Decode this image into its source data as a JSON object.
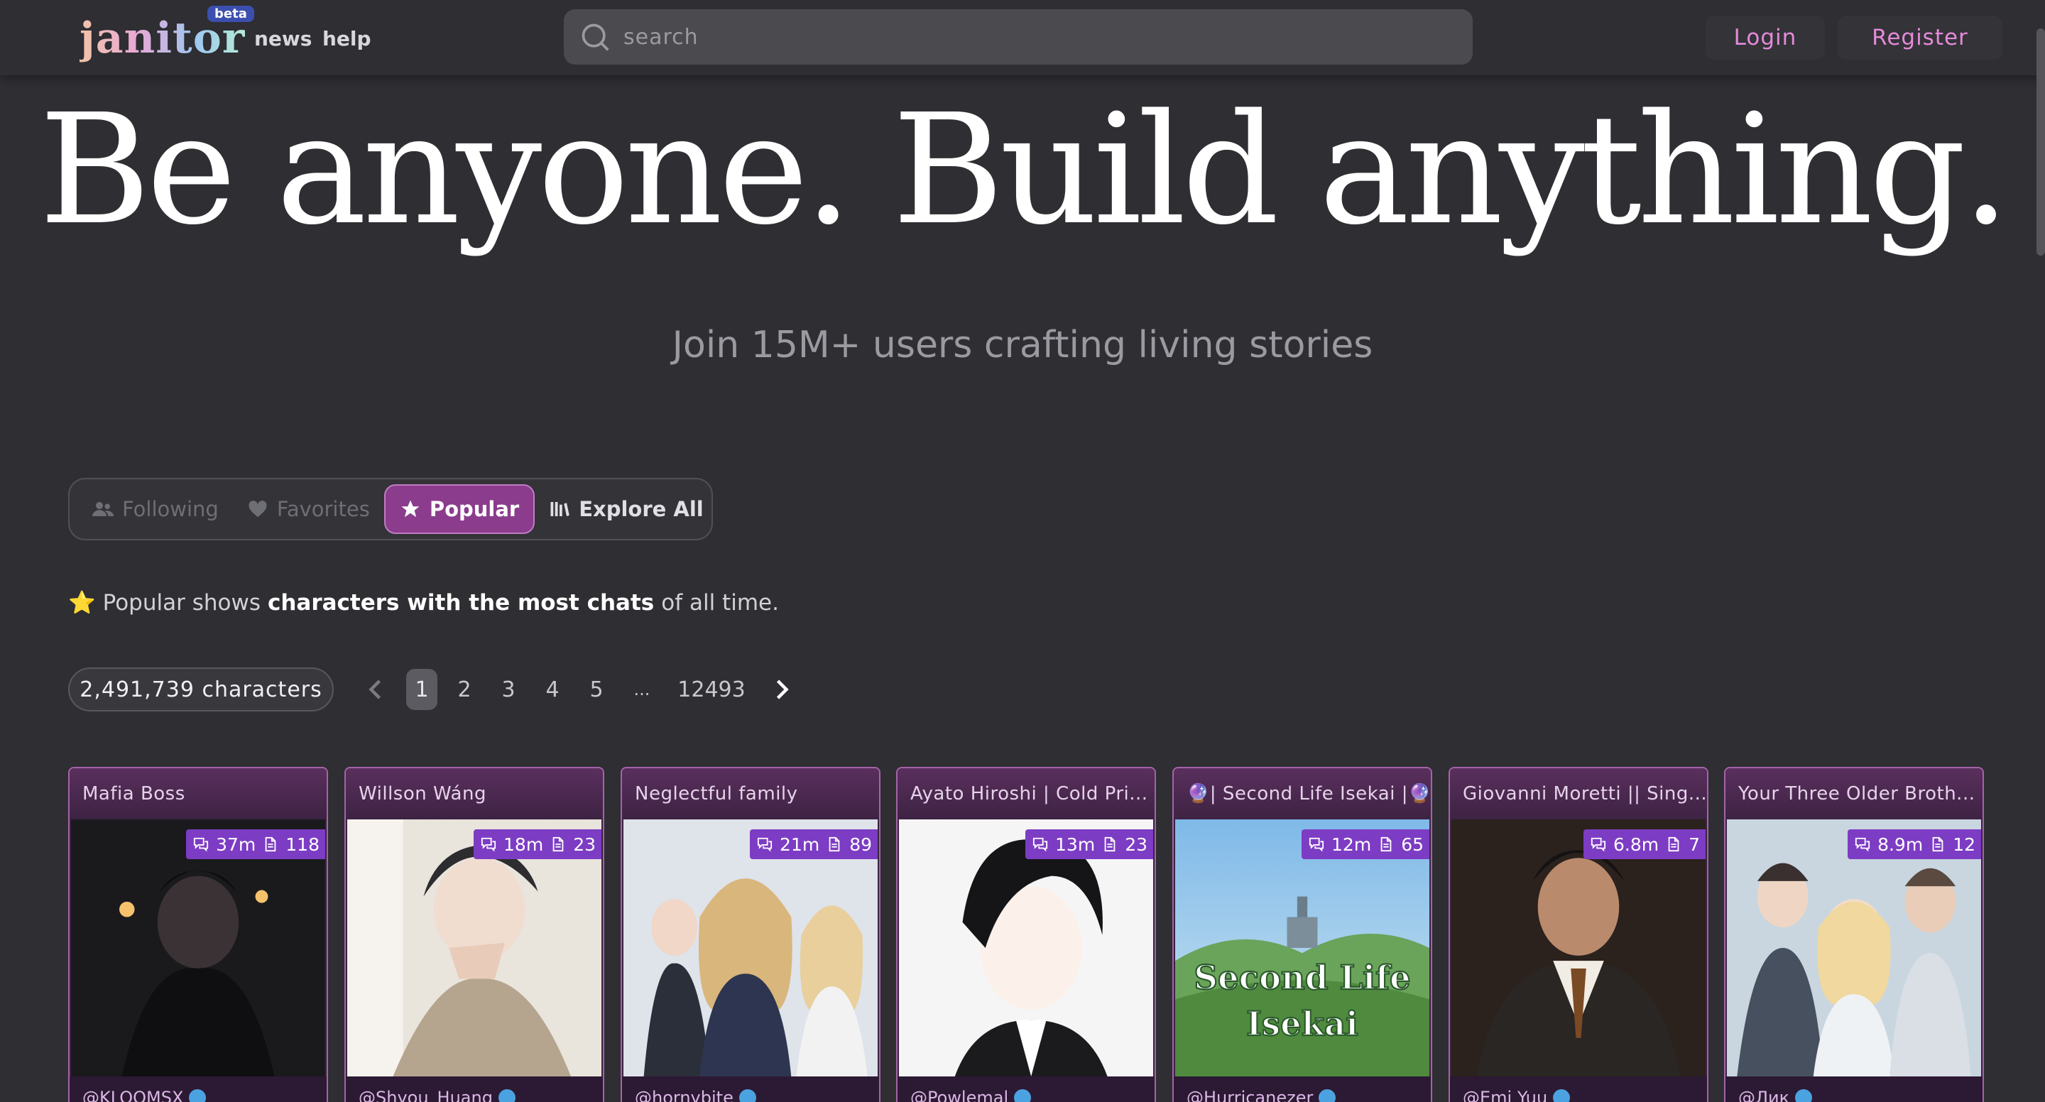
{
  "header": {
    "logo_text": "janitor",
    "beta_label": "beta",
    "nav": [
      {
        "label": "news"
      },
      {
        "label": "help"
      }
    ],
    "search": {
      "placeholder": "search",
      "value": ""
    },
    "login_label": "Login",
    "register_label": "Register"
  },
  "hero": {
    "title": "Be anyone. Build anything.",
    "subtitle": "Join 15M+ users crafting living stories"
  },
  "tabs": [
    {
      "label": "Following",
      "icon": "users-icon",
      "active": false
    },
    {
      "label": "Favorites",
      "icon": "heart-icon",
      "active": false
    },
    {
      "label": "Popular",
      "icon": "star-icon",
      "active": true
    },
    {
      "label": "Explore All",
      "icon": "library-icon",
      "active": false
    }
  ],
  "info": {
    "emoji": "⭐",
    "part1": "Popular shows",
    "part2": "characters with the most chats",
    "part3": "of all time."
  },
  "pagination": {
    "count_label": "2,491,739 characters",
    "pages": [
      "1",
      "2",
      "3",
      "4",
      "5",
      "...",
      "12493"
    ],
    "current": "1"
  },
  "cards": [
    {
      "title": "Mafia Boss",
      "chats": "37m",
      "messages": "118",
      "author": "@KLOOMSX",
      "art": "dark"
    },
    {
      "title": "Willson Wáng",
      "chats": "18m",
      "messages": "23",
      "author": "@Shyou_Huang",
      "art": "sketch"
    },
    {
      "title": "Neglectful family",
      "chats": "21m",
      "messages": "89",
      "author": "@hornybite",
      "art": "family"
    },
    {
      "title": "Ayato Hiroshi | Cold Pri...",
      "chats": "13m",
      "messages": "23",
      "author": "@Powlemal",
      "art": "manga"
    },
    {
      "title": "🔮| Second Life Isekai |🔮",
      "chats": "12m",
      "messages": "65",
      "author": "@Hurricanezer",
      "art": "landscape",
      "art_text_1": "Second Life",
      "art_text_2": "Isekai"
    },
    {
      "title": "Giovanni Moretti || Sing...",
      "chats": "6.8m",
      "messages": "7",
      "author": "@Emi Yuu",
      "art": "suit"
    },
    {
      "title": "Your Three Older Broth...",
      "chats": "8.9m",
      "messages": "12",
      "author": "@Лик",
      "art": "brothers"
    }
  ],
  "colors": {
    "background": "#2e2e33",
    "accent_pink": "#e58ad9",
    "active_tab": "#8b3c8c",
    "card_border": "#a563a9",
    "stats_badge": "#7d3cc4"
  }
}
